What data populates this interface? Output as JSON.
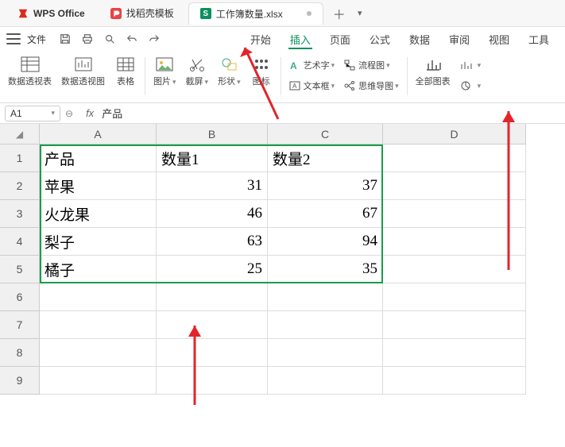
{
  "tabs": {
    "wps": "WPS Office",
    "dao": "找稻壳模板",
    "doc": "工作簿数量.xlsx"
  },
  "file_label": "文件",
  "menu": [
    "开始",
    "插入",
    "页面",
    "公式",
    "数据",
    "审阅",
    "视图",
    "工具"
  ],
  "menu_active_index": 1,
  "ribbon": {
    "pivot_table": "数据透视表",
    "pivot_chart": "数据透视图",
    "table": "表格",
    "pictures": "图片",
    "screenshot": "截屏",
    "shapes": "形状",
    "icons": "图标",
    "wordart": "艺术字",
    "textbox": "文本框",
    "flowchart": "流程图",
    "mindmap": "思维导图",
    "all_charts": "全部图表"
  },
  "cell_ref": "A1",
  "cell_val": "产品",
  "cols": [
    "A",
    "B",
    "C",
    "D"
  ],
  "row_labels": [
    "1",
    "2",
    "3",
    "4",
    "5",
    "6",
    "7",
    "8",
    "9"
  ],
  "chart_data": {
    "type": "table",
    "headers": [
      "产品",
      "数量1",
      "数量2"
    ],
    "rows": [
      [
        "苹果",
        31,
        37
      ],
      [
        "火龙果",
        46,
        67
      ],
      [
        "梨子",
        63,
        94
      ],
      [
        "橘子",
        25,
        35
      ]
    ]
  }
}
